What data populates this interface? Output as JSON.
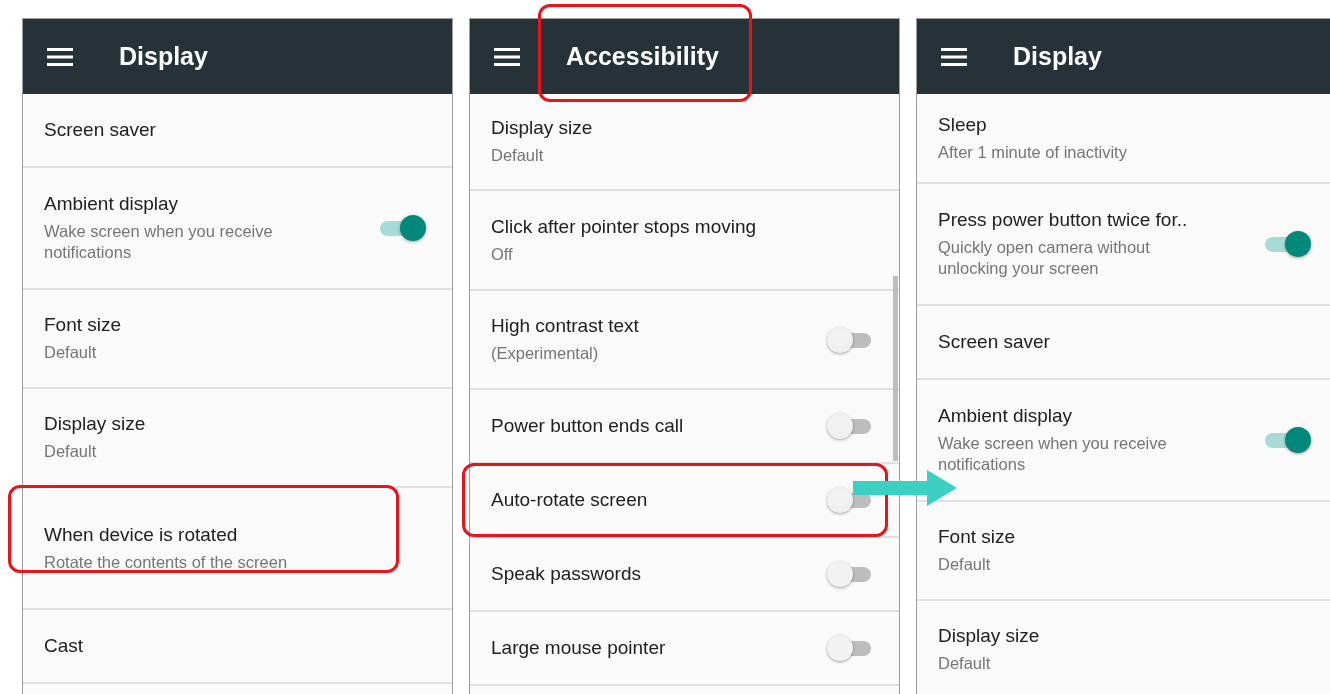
{
  "panels": [
    {
      "title": "Display",
      "title_highlighted": false,
      "scrollbar": false,
      "items": [
        {
          "kind": "plain",
          "title": "Screen saver",
          "highlighted": false
        },
        {
          "kind": "toggle",
          "title": "Ambient display",
          "subtitle": "Wake screen when you receive notifications",
          "on": true,
          "highlighted": false
        },
        {
          "kind": "plain",
          "title": "Font size",
          "subtitle": "Default",
          "highlighted": false
        },
        {
          "kind": "plain",
          "title": "Display size",
          "subtitle": "Default",
          "highlighted": false
        },
        {
          "kind": "plain",
          "title": "When device is rotated",
          "subtitle": "Rotate the contents of the screen",
          "highlighted": true
        },
        {
          "kind": "plain",
          "title": "Cast",
          "highlighted": false
        }
      ]
    },
    {
      "title": "Accessibility",
      "title_highlighted": true,
      "scrollbar": true,
      "items": [
        {
          "kind": "plain",
          "title": "Display size",
          "subtitle": "Default",
          "highlighted": false
        },
        {
          "kind": "plain",
          "title": "Click after pointer stops moving",
          "subtitle": "Off",
          "highlighted": false
        },
        {
          "kind": "toggle",
          "title": "High contrast text",
          "subtitle": "(Experimental)",
          "on": false,
          "highlighted": false
        },
        {
          "kind": "toggle",
          "title": "Power button ends call",
          "on": false,
          "highlighted": false
        },
        {
          "kind": "toggle",
          "title": "Auto-rotate screen",
          "on": false,
          "highlighted": true
        },
        {
          "kind": "toggle",
          "title": "Speak passwords",
          "on": false,
          "highlighted": false
        },
        {
          "kind": "toggle",
          "title": "Large mouse pointer",
          "on": false,
          "highlighted": false
        }
      ]
    },
    {
      "title": "Display",
      "title_highlighted": false,
      "scrollbar": false,
      "items": [
        {
          "kind": "plain",
          "title": "Sleep",
          "subtitle": "After 1 minute of inactivity",
          "highlighted": false
        },
        {
          "kind": "toggle",
          "title": "Press power button twice for..",
          "subtitle": "Quickly open camera without unlocking your screen",
          "on": true,
          "highlighted": false
        },
        {
          "kind": "plain",
          "title": "Screen saver",
          "highlighted": false
        },
        {
          "kind": "toggle",
          "title": "Ambient display",
          "subtitle": "Wake screen when you receive notifications",
          "on": true,
          "highlighted": false
        },
        {
          "kind": "plain",
          "title": "Font size",
          "subtitle": "Default",
          "highlighted": false
        },
        {
          "kind": "plain",
          "title": "Display size",
          "subtitle": "Default",
          "highlighted": false
        }
      ]
    }
  ]
}
